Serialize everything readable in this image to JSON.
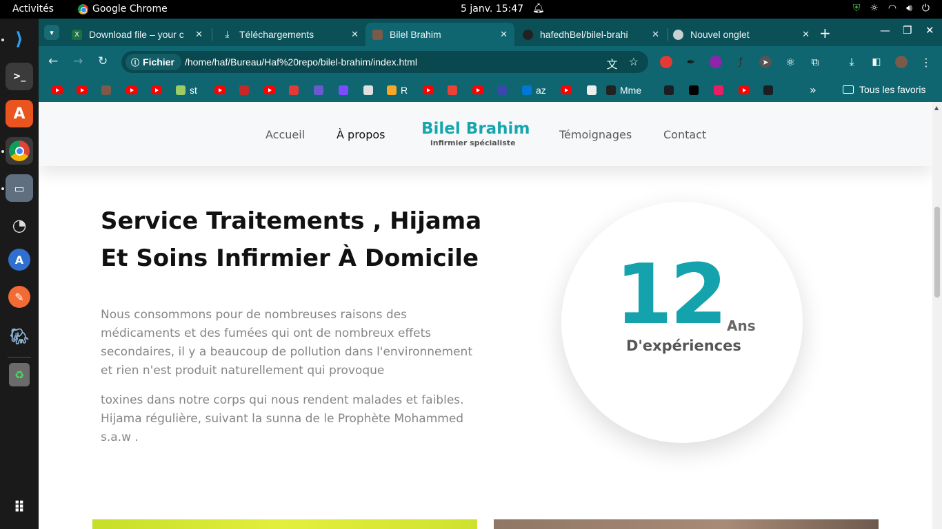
{
  "topbar": {
    "activities": "Activités",
    "app_name": "Google Chrome",
    "clock": "5 janv.  15:47"
  },
  "tabs": [
    {
      "title": "Download file – your c",
      "favicon": "excel-icon",
      "color": "#1d7044"
    },
    {
      "title": "Téléchargements",
      "favicon": "download-icon",
      "color": "transparent"
    },
    {
      "title": "Bilel Brahim",
      "favicon": "profile-photo-icon",
      "color": "#7a5a48"
    },
    {
      "title": "hafedhBel/bilel-brahi",
      "favicon": "github-icon",
      "color": "#222"
    },
    {
      "title": "Nouvel onglet",
      "favicon": "chrome-icon",
      "color": "transparent"
    }
  ],
  "toolbar": {
    "security_chip": "Fichier",
    "url": "/home/haf/Bureau/Haf%20repo/bilel-brahim/index.html"
  },
  "bookmarks": {
    "items": [
      {
        "label": "",
        "icon": "youtube-icon"
      },
      {
        "label": "",
        "icon": "youtube-icon"
      },
      {
        "label": "",
        "icon": "profile-icon"
      },
      {
        "label": "",
        "icon": "youtube-icon"
      },
      {
        "label": "",
        "icon": "youtube-icon"
      },
      {
        "label": "st",
        "icon": "image-icon"
      },
      {
        "label": "",
        "icon": "youtube-icon"
      },
      {
        "label": "",
        "icon": "red-logo-icon"
      },
      {
        "label": "",
        "icon": "youtube-icon"
      },
      {
        "label": "",
        "icon": "c-logo-icon"
      },
      {
        "label": "",
        "icon": "m-logo-icon"
      },
      {
        "label": "",
        "icon": "u-logo-icon"
      },
      {
        "label": "",
        "icon": "grid-logo-icon"
      },
      {
        "label": "R",
        "icon": "b-coin-icon"
      },
      {
        "label": "",
        "icon": "youtube-icon"
      },
      {
        "label": "",
        "icon": "gmail-icon"
      },
      {
        "label": "",
        "icon": "youtube-icon"
      },
      {
        "label": "",
        "icon": "e-logo-icon"
      },
      {
        "label": "az",
        "icon": "azure-icon"
      },
      {
        "label": "",
        "icon": "youtube-icon"
      },
      {
        "label": "",
        "icon": "c-box-icon"
      },
      {
        "label": "Mme",
        "icon": "dark-logo-icon"
      },
      {
        "label": "",
        "icon": "github-icon"
      },
      {
        "label": "",
        "icon": "dev-icon"
      },
      {
        "label": "",
        "icon": "target-icon"
      },
      {
        "label": "",
        "icon": "youtube-icon"
      },
      {
        "label": "",
        "icon": "github-icon"
      }
    ],
    "all_bookmarks": "Tous les favoris"
  },
  "site": {
    "nav": {
      "home": "Accueil",
      "about": "À propos",
      "brand_name": "Bilel Brahim",
      "brand_subtitle": "infirmier spécialiste",
      "testimonials": "Témoignages",
      "contact": "Contact"
    },
    "hero": {
      "title": "Service Traitements , Hijama Et Soins Infirmier À Domicile",
      "paragraph1": "Nous consommons pour de nombreuses raisons des médicaments et des fumées qui ont de nombreux effets secondaires, il y a beaucoup de pollution dans l'environnement et rien n'est produit naturellement qui provoque",
      "paragraph2": "toxines dans notre corps qui nous rendent malades et faibles. Hijama régulière, suivant la sunna de le Prophète Mohammed s.a.w ."
    },
    "experience": {
      "years": "12",
      "unit": "Ans",
      "label": "D'expériences"
    }
  },
  "colors": {
    "accent": "#17a6ae",
    "chrome_frame": "#0f6670",
    "chrome_tabstrip": "#0b4f57"
  }
}
